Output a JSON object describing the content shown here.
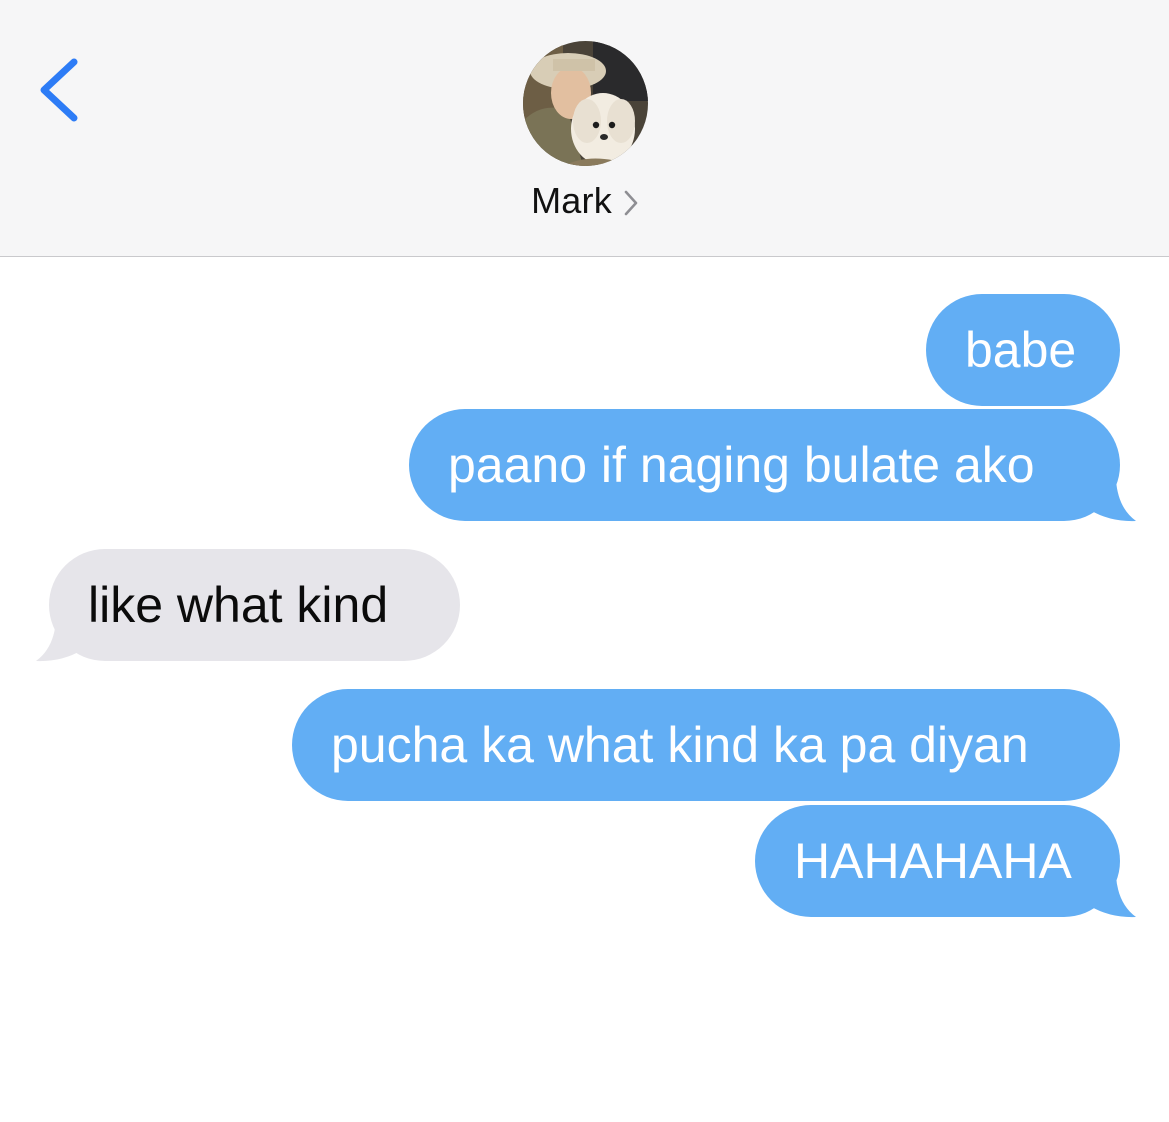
{
  "header": {
    "contact_name": "Mark"
  },
  "colors": {
    "sent_bubble": "#62aef4",
    "received_bubble": "#e6e5ea",
    "accent": "#2d7cf6",
    "header_bg": "#f6f6f7"
  },
  "icons": {
    "back": "chevron-left-icon",
    "contact_detail": "chevron-right-icon"
  },
  "messages": [
    {
      "direction": "sent",
      "text": "babe"
    },
    {
      "direction": "sent",
      "text": "paano if naging bulate ako"
    },
    {
      "direction": "received",
      "text": "like what kind"
    },
    {
      "direction": "sent",
      "text": "pucha ka what kind ka pa diyan"
    },
    {
      "direction": "sent",
      "text": "HAHAHAHA"
    }
  ]
}
